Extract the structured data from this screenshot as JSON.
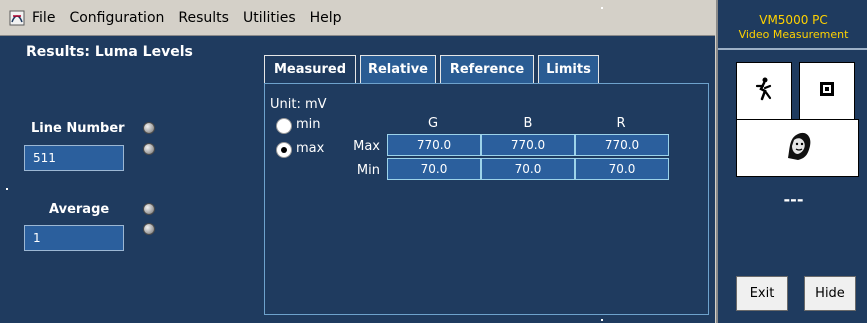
{
  "menubar": {
    "items": [
      "File",
      "Configuration",
      "Results",
      "Utilities",
      "Help"
    ]
  },
  "main": {
    "title": "Results: Luma Levels",
    "line_number_label": "Line Number",
    "line_number_value": "511",
    "average_label": "Average",
    "average_value": "1",
    "tabs": [
      {
        "label": "Measured",
        "active": true
      },
      {
        "label": "Relative",
        "active": false
      },
      {
        "label": "Reference",
        "active": false
      },
      {
        "label": "Limits",
        "active": false
      }
    ],
    "unit_label": "Unit: mV",
    "radios": [
      {
        "label": "min",
        "checked": false
      },
      {
        "label": "max",
        "checked": true
      }
    ],
    "table": {
      "columns": [
        "G",
        "B",
        "R"
      ],
      "rows": [
        {
          "label": "Max",
          "values": [
            "770.0",
            "770.0",
            "770.0"
          ]
        },
        {
          "label": "Min",
          "values": [
            "70.0",
            "70.0",
            "70.0"
          ]
        }
      ]
    }
  },
  "right": {
    "brand1": "VM5000 PC",
    "brand2": "Video Measurement",
    "status_text": "---",
    "exit_label": "Exit",
    "hide_label": "Hide"
  },
  "colors": {
    "background": "#1f3b5f",
    "accent": "#ffd200",
    "menubar": "#d4d0c8"
  },
  "icons": [
    "app-icon",
    "runner-icon",
    "stop-icon",
    "face-icon"
  ]
}
